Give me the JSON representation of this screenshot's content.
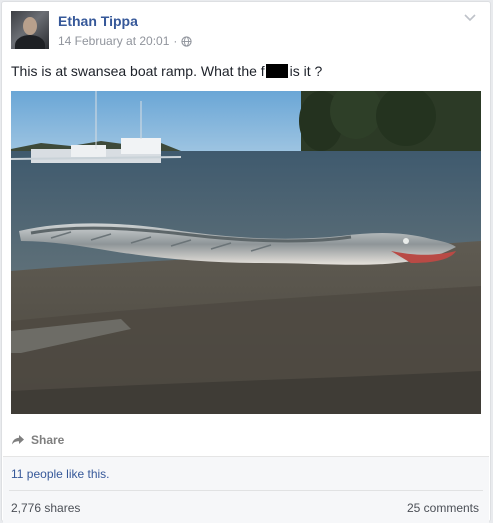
{
  "post": {
    "author": "Ethan Tippa",
    "timestamp": "14 February at 20:01",
    "separator": "·",
    "privacy_icon": "globe-icon",
    "text_before": "This is at swansea boat ramp. What the f",
    "text_after": " is it ?",
    "photo_icon": "eel-photo"
  },
  "actions": {
    "share_label": "Share",
    "share_icon": "share-arrow-icon"
  },
  "engagement": {
    "likes": "11 people like this.",
    "shares": "2,776 shares",
    "comments": "25 comments"
  },
  "colors": {
    "name_link": "#365899",
    "meta_gray": "#90949c",
    "card_border": "#dddfe2"
  }
}
